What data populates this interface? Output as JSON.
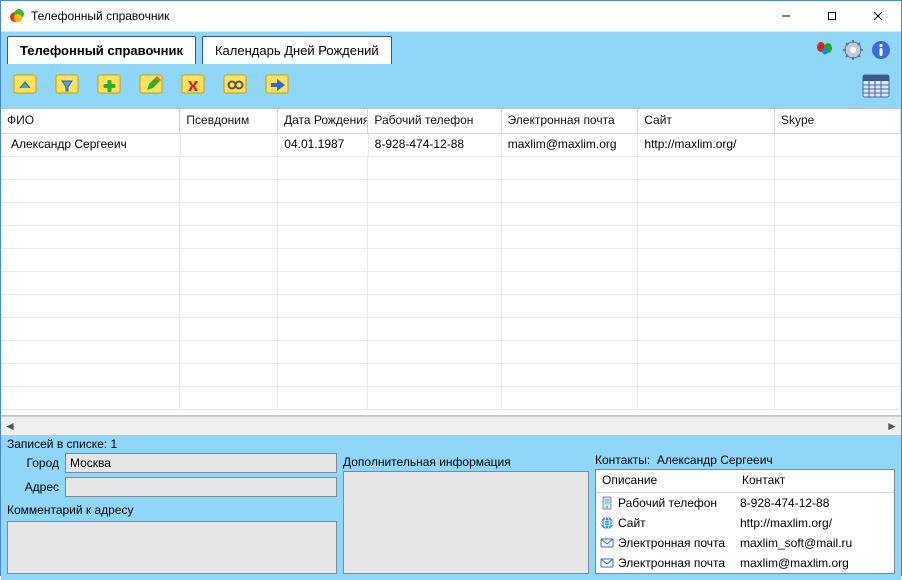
{
  "window": {
    "title": "Телефонный справочник"
  },
  "tabs": [
    {
      "label": "Телефонный справочник",
      "active": true
    },
    {
      "label": "Календарь Дней Рождений",
      "active": false
    }
  ],
  "grid": {
    "columns": [
      "ФИО",
      "Псевдоним",
      "Дата Рождения",
      "Рабочий телефон",
      "Электронная почта",
      "Сайт",
      "Skype"
    ],
    "rows": [
      {
        "fio": "Александр Сергееич",
        "pseud": "",
        "dob": "04.01.1987",
        "wphone": "8-928-474-12-88",
        "email": "maxlim@maxlim.org",
        "site": "http://maxlim.org/",
        "skype": ""
      }
    ]
  },
  "status": {
    "count_label": "Записей в списке: 1"
  },
  "address_panel": {
    "city_label": "Город",
    "city_value": "Москва",
    "address_label": "Адрес",
    "address_value": "",
    "comment_label": "Комментарий к адресу"
  },
  "extra_panel": {
    "label": "Дополнительная информация"
  },
  "contacts_panel": {
    "header_prefix": "Контакты:",
    "header_name": "Александр Сергееич",
    "col_desc": "Описание",
    "col_contact": "Контакт",
    "rows": [
      {
        "icon": "phone",
        "desc": "Рабочий телефон",
        "contact": "8-928-474-12-88"
      },
      {
        "icon": "globe",
        "desc": "Сайт",
        "contact": "http://maxlim.org/"
      },
      {
        "icon": "mail",
        "desc": "Электронная почта",
        "contact": "maxlim_soft@mail.ru"
      },
      {
        "icon": "mail",
        "desc": "Электронная почта",
        "contact": "maxlim@maxlim.org"
      }
    ]
  }
}
